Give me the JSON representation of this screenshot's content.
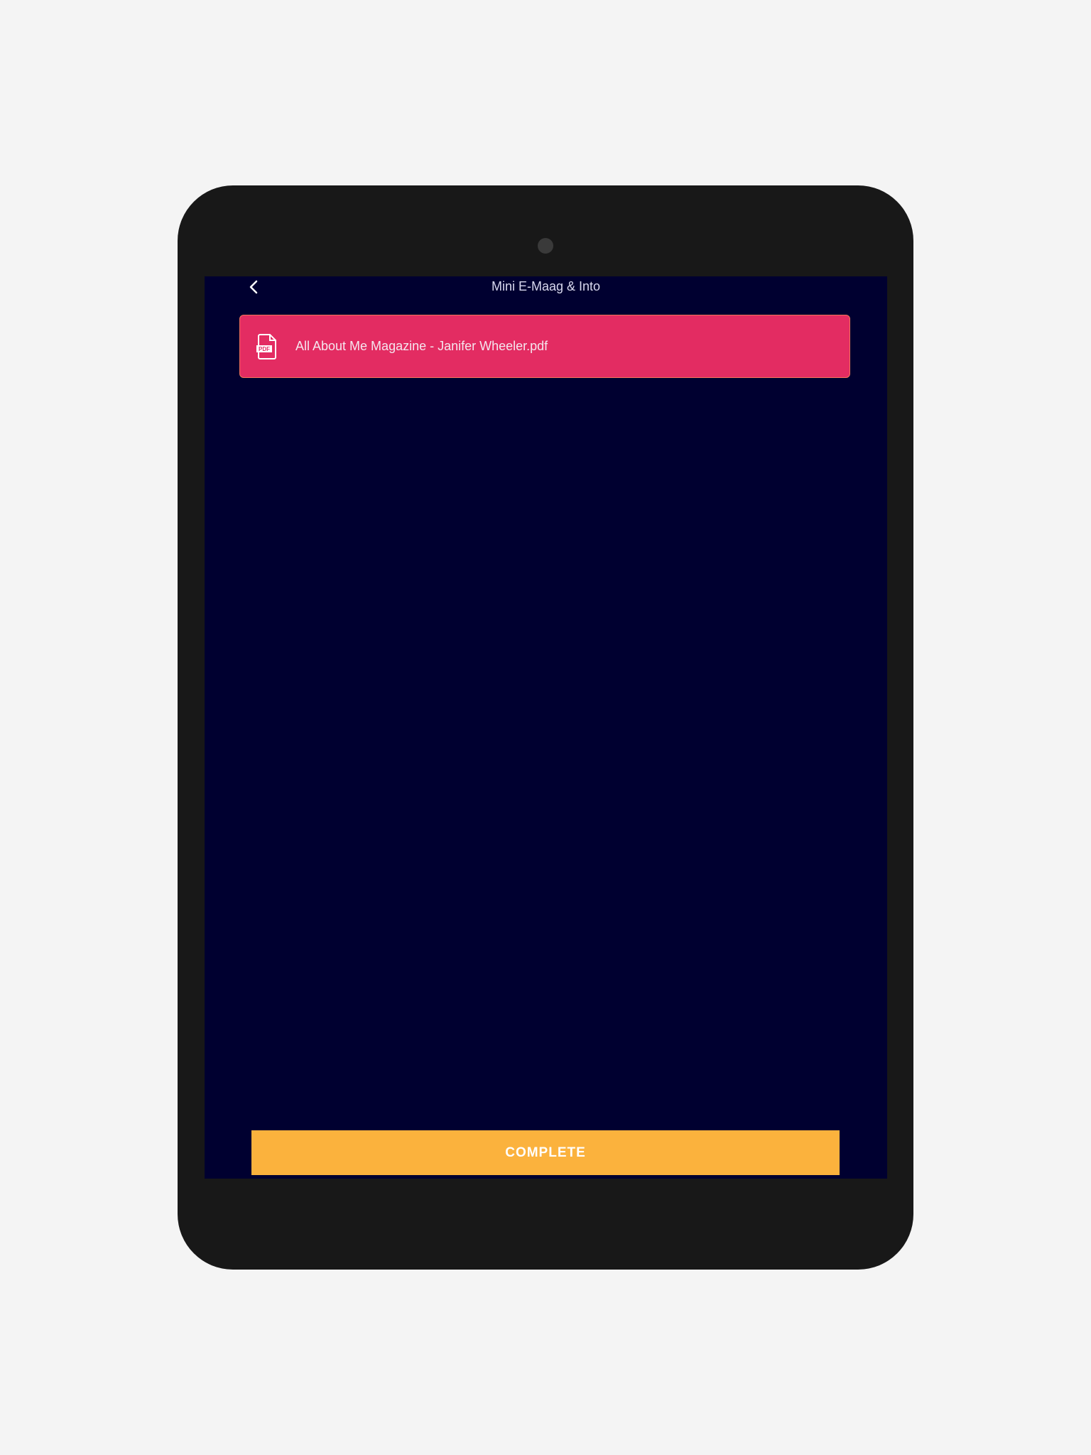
{
  "header": {
    "title": "Mini E-Maag & Into",
    "back_icon": "chevron-left-icon"
  },
  "attachment": {
    "file_name": "All About Me Magazine - Janifer Wheeler.pdf",
    "icon": "pdf-file-icon",
    "icon_text": "PDF",
    "color": "#e32c62"
  },
  "footer": {
    "complete_label": "COMPLETE",
    "color": "#fbb23d"
  },
  "theme": {
    "background": "#000030"
  }
}
